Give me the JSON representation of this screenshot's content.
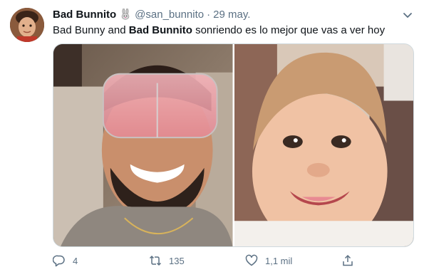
{
  "tweet": {
    "author": {
      "display_name": "Bad Bunnito",
      "handle": "@san_bunnito",
      "name_emoji": "rabbit-emoji"
    },
    "separator": "·",
    "date": "29 may.",
    "text": {
      "part1": "Bad Bunny and ",
      "bold": "Bad Bunnito",
      "part2": " sonriendo es lo mejor que vas a ver hoy"
    },
    "media": [
      {
        "name": "photo-bad-bunny",
        "description_icon": "photo"
      },
      {
        "name": "photo-baby",
        "description_icon": "photo"
      }
    ],
    "actions": {
      "replies": "4",
      "retweets": "135",
      "likes": "1,1 mil"
    }
  },
  "colors": {
    "text": "#0f1419",
    "secondary": "#5b7083",
    "border": "#cfd9de"
  }
}
